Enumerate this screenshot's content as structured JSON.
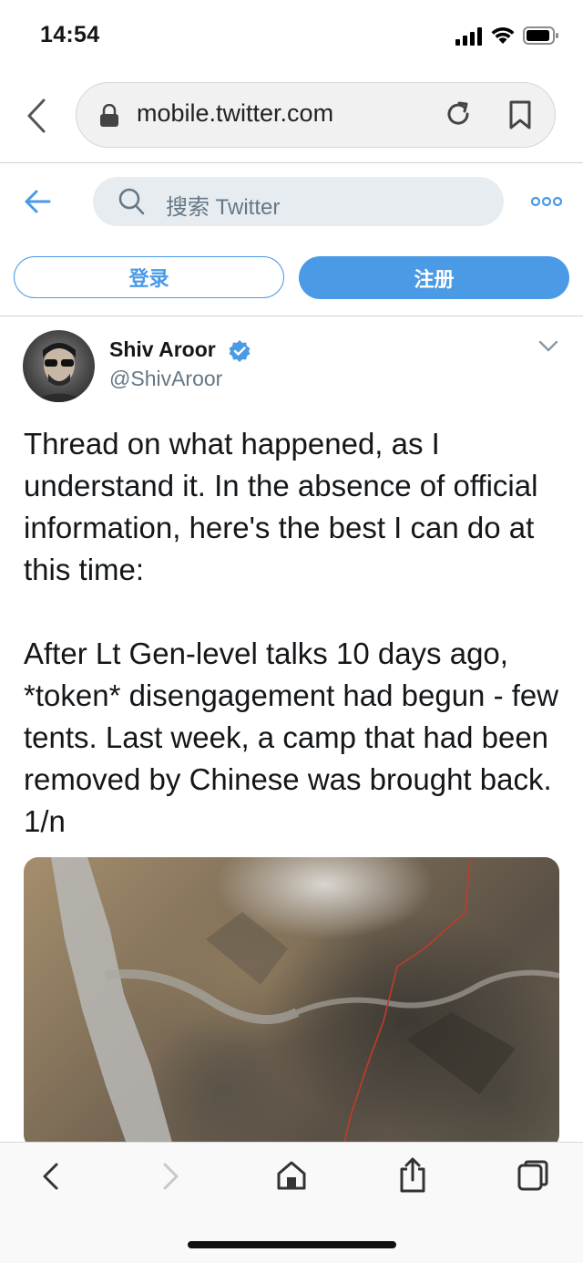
{
  "status_bar": {
    "time": "14:54"
  },
  "browser": {
    "url": "mobile.twitter.com",
    "icons": {
      "back": "chevron-left-icon",
      "lock": "lock-icon",
      "reload": "reload-icon",
      "bookmark": "bookmark-icon"
    }
  },
  "twitter_header": {
    "search_placeholder": "搜索 Twitter",
    "login_label": "登录",
    "signup_label": "注册",
    "accent_color": "#4a9ae6"
  },
  "tweet": {
    "author_name": "Shiv Aroor",
    "author_handle": "@ShivAroor",
    "verified": true,
    "text": "Thread on what happened, as I understand it. In the absence of official information, here's the best I can do at this time:\n\nAfter Lt Gen-level talks 10 days ago, *token* disengagement had begun - few tents. Last week, a camp that had been removed by Chinese was brought back. 1/n",
    "media": "satellite-image"
  },
  "toolbar": {
    "icons": [
      "back-icon",
      "forward-icon",
      "home-icon",
      "share-icon",
      "tabs-icon"
    ]
  }
}
